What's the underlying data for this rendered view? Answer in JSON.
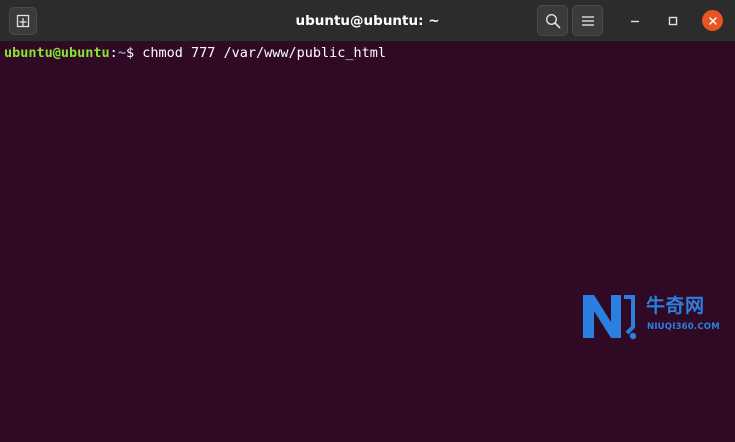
{
  "window": {
    "title": "ubuntu@ubuntu: ~"
  },
  "colors": {
    "terminal_background": "#300a24",
    "titlebar_background": "#2c2c2c",
    "prompt_user": "#8ae234",
    "prompt_path": "#729fcf",
    "close_button": "#e95420",
    "watermark_blue": "#2b7fe0"
  },
  "titlebar": {
    "icons": {
      "new_tab": "new-tab-icon",
      "search": "search-icon",
      "menu": "hamburger-menu-icon",
      "minimize": "minimize-icon",
      "maximize": "maximize-icon",
      "close": "close-icon"
    }
  },
  "terminal": {
    "prompt": {
      "user_host": "ubuntu@ubuntu",
      "separator": ":",
      "path": "~",
      "symbol": "$"
    },
    "command": " chmod 777 /var/www/public_html"
  },
  "watermark": {
    "brand_cn": "牛奇网",
    "brand_en": "NIUQI360.COM"
  }
}
